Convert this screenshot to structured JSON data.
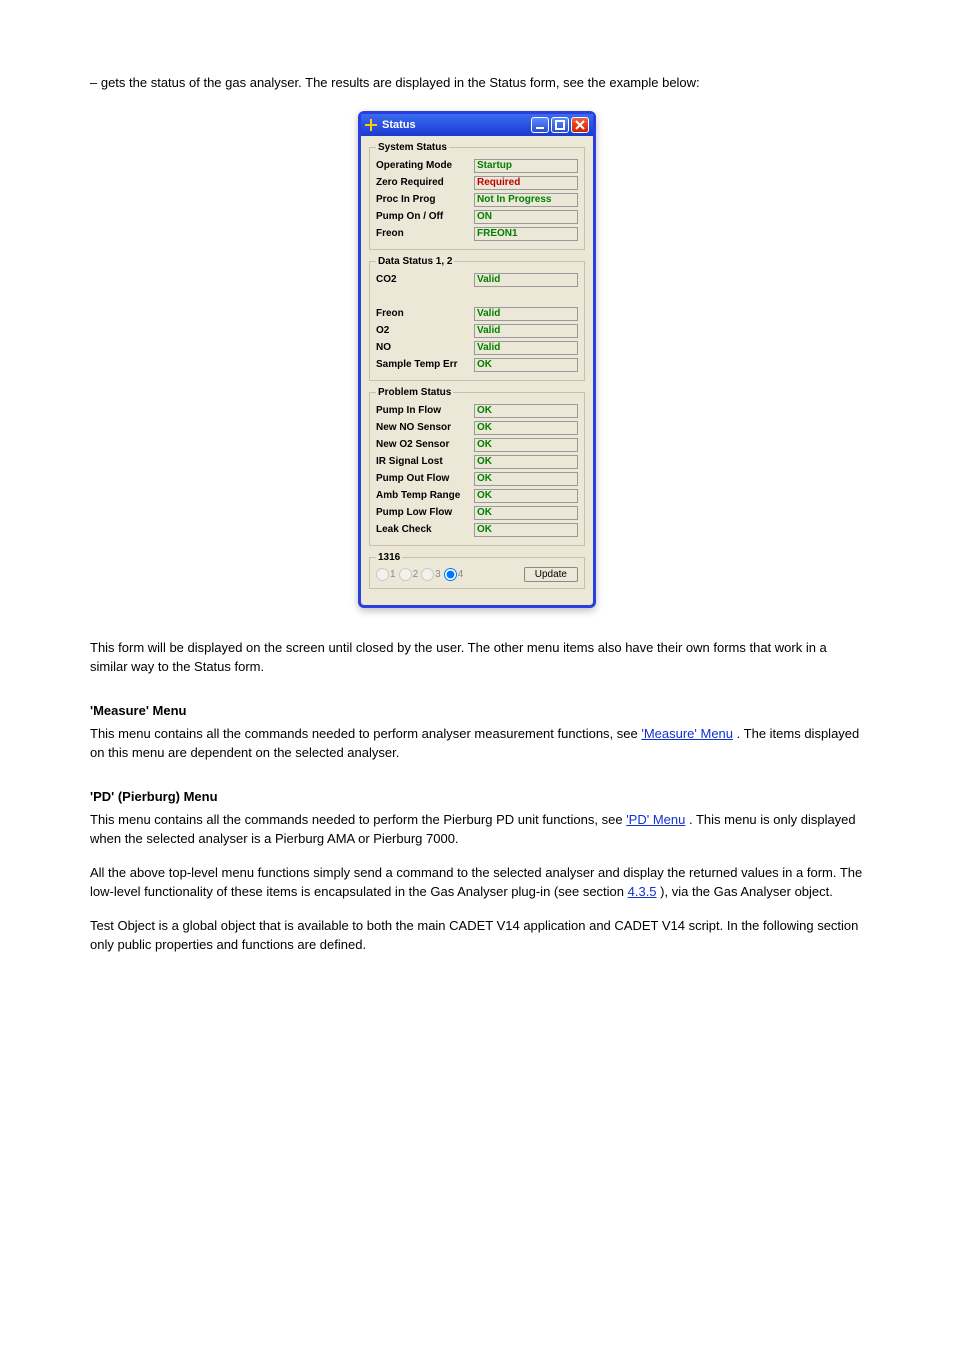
{
  "intro_paragraph": "– gets the status of the gas analyser. The results are displayed in the Status form, see the example below:",
  "window": {
    "title": "Status",
    "groups": [
      {
        "legend": "System Status",
        "rows": [
          {
            "label": "Operating Mode",
            "value": "Startup",
            "cls": "green"
          },
          {
            "label": "Zero Required",
            "value": "Required",
            "cls": "red"
          },
          {
            "label": "Proc In Prog",
            "value": "Not In Progress",
            "cls": "green"
          },
          {
            "label": "Pump On / Off",
            "value": "ON",
            "cls": "green"
          },
          {
            "label": "Freon",
            "value": "FREON1",
            "cls": "green"
          }
        ]
      },
      {
        "legend": "Data Status 1, 2",
        "rows": [
          {
            "label": "CO2",
            "value": "Valid",
            "cls": "green"
          },
          {
            "label": "",
            "value": "",
            "cls": "",
            "blank": true
          },
          {
            "label": "Freon",
            "value": "Valid",
            "cls": "green"
          },
          {
            "label": "O2",
            "value": "Valid",
            "cls": "green"
          },
          {
            "label": "NO",
            "value": "Valid",
            "cls": "green"
          },
          {
            "label": "Sample Temp Err",
            "value": "OK",
            "cls": "green"
          }
        ]
      },
      {
        "legend": "Problem Status",
        "rows": [
          {
            "label": "Pump In Flow",
            "value": "OK",
            "cls": "green"
          },
          {
            "label": "New NO Sensor",
            "value": "OK",
            "cls": "green"
          },
          {
            "label": "New O2 Sensor",
            "value": "OK",
            "cls": "green"
          },
          {
            "label": "IR Signal Lost",
            "value": "OK",
            "cls": "green"
          },
          {
            "label": "Pump Out Flow",
            "value": "OK",
            "cls": "green"
          },
          {
            "label": "Amb Temp Range",
            "value": "OK",
            "cls": "green"
          },
          {
            "label": "Pump Low Flow",
            "value": "OK",
            "cls": "green"
          },
          {
            "label": "Leak Check",
            "value": "OK",
            "cls": "green"
          }
        ]
      }
    ],
    "radio_legend": "1316",
    "radio_opts": [
      "1",
      "2",
      "3",
      "4"
    ],
    "radio_selected": "4",
    "update_label": "Update"
  },
  "below_window": "This form will be displayed on the screen until closed by the user. The other menu items also have their own forms that work in a similar way to the Status form.",
  "heading_measure": "'Measure' Menu",
  "measure_intro": "This menu contains all the commands needed to perform analyser measurement functions, see ",
  "measure_link": "'Measure' Menu",
  "measure_after": ". The items displayed on this menu are dependent on the selected analyser.",
  "heading_pd": "'PD' (Pierburg) Menu",
  "pd_text_1": "This menu contains all the commands needed to perform the Pierburg PD unit functions, see ",
  "pd_link_1": "'PD' Menu",
  "pd_text_2": ". This menu is only displayed when the selected analyser is a Pierburg AMA or Pierburg 7000.",
  "info_para_1": "All the above top-level menu functions simply send a command to the selected analyser and display the returned values in a form. The low-level functionality of these items is encapsulated in the Gas Analyser plug-in (see section ",
  "info_link_sec": "4.3.5",
  "info_para_2": "), via the Gas Analyser object.",
  "testobj_para": "Test Object is a global object that is available to both the main CADET V14 application and CADET V14 script. In the following section only public properties and functions are defined."
}
